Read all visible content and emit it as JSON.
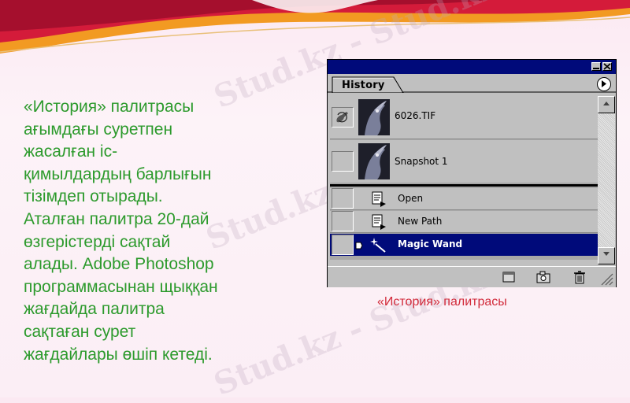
{
  "slide": {
    "text_lines": [
      "«История» палитрасы",
      "ағымдағы  суретпен",
      "жасалған  іс-",
      "қимылдардың  барлығын",
      "тізімдеп  отырады.",
      "Аталған  палитра  20-дай",
      "өзгерістерді  сақтай",
      "алады. Adobe Photoshop",
      "программасынан  щыққан",
      "жағдайда  палитра",
      "сақтаған  сурет",
      "жағдайлары  өшіп кетеді."
    ],
    "caption": "«История»  палитрасы",
    "watermark": "Stud.kz - Stud.kz",
    "colors": {
      "text": "#2c9a2c",
      "caption": "#d22a3a",
      "banner_red": "#c8102e",
      "banner_orange": "#f08a1c"
    }
  },
  "palette": {
    "tab_label": "History",
    "title_buttons": [
      "minimize-icon",
      "close-icon"
    ],
    "menu_icon": "triangle-right-icon",
    "snapshots": [
      {
        "label": "6026.TIF",
        "icon": "history-brush-icon"
      },
      {
        "label": "Snapshot 1",
        "icon": ""
      }
    ],
    "states": [
      {
        "label": "Open",
        "icon": "document-icon",
        "selected": false
      },
      {
        "label": "New Path",
        "icon": "document-icon",
        "selected": false
      },
      {
        "label": "Magic Wand",
        "icon": "magic-wand-icon",
        "selected": true
      }
    ],
    "bottom_icons": [
      "new-document-icon",
      "camera-icon",
      "trash-icon",
      "resize-grip-icon"
    ],
    "colors": {
      "titlebar": "#000a7a",
      "selected": "#000a7a",
      "panel": "#c0c0c0"
    }
  }
}
